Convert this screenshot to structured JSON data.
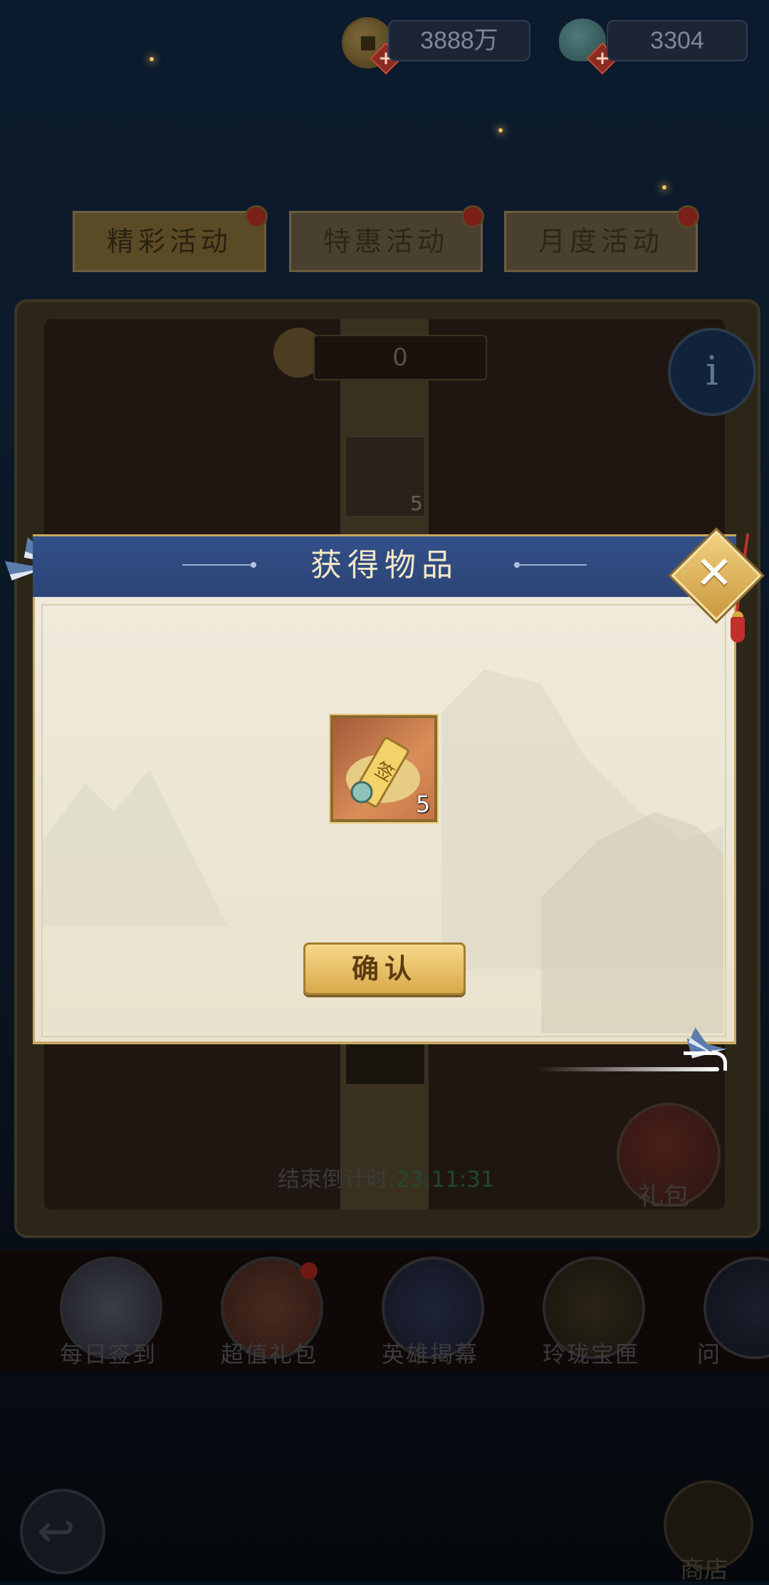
{
  "currency": {
    "coins": "3888万",
    "shells": "3304"
  },
  "tabs": [
    {
      "label": "精彩活动"
    },
    {
      "label": "特惠活动"
    },
    {
      "label": "月度活动"
    }
  ],
  "event": {
    "counter": "0",
    "item_count": "5",
    "countdown_label": "结束倒计时:",
    "countdown_time": "23:11:31",
    "gift_label": "礼包"
  },
  "nav": [
    {
      "label": "每日签到"
    },
    {
      "label": "超值礼包"
    },
    {
      "label": "英雄揭幕"
    },
    {
      "label": "玲珑宝匣"
    },
    {
      "label": "问"
    }
  ],
  "shop_label": "商店",
  "dialog": {
    "title": "获得物品",
    "item_quantity": "5",
    "item_glyph": "签",
    "confirm_label": "确认"
  }
}
